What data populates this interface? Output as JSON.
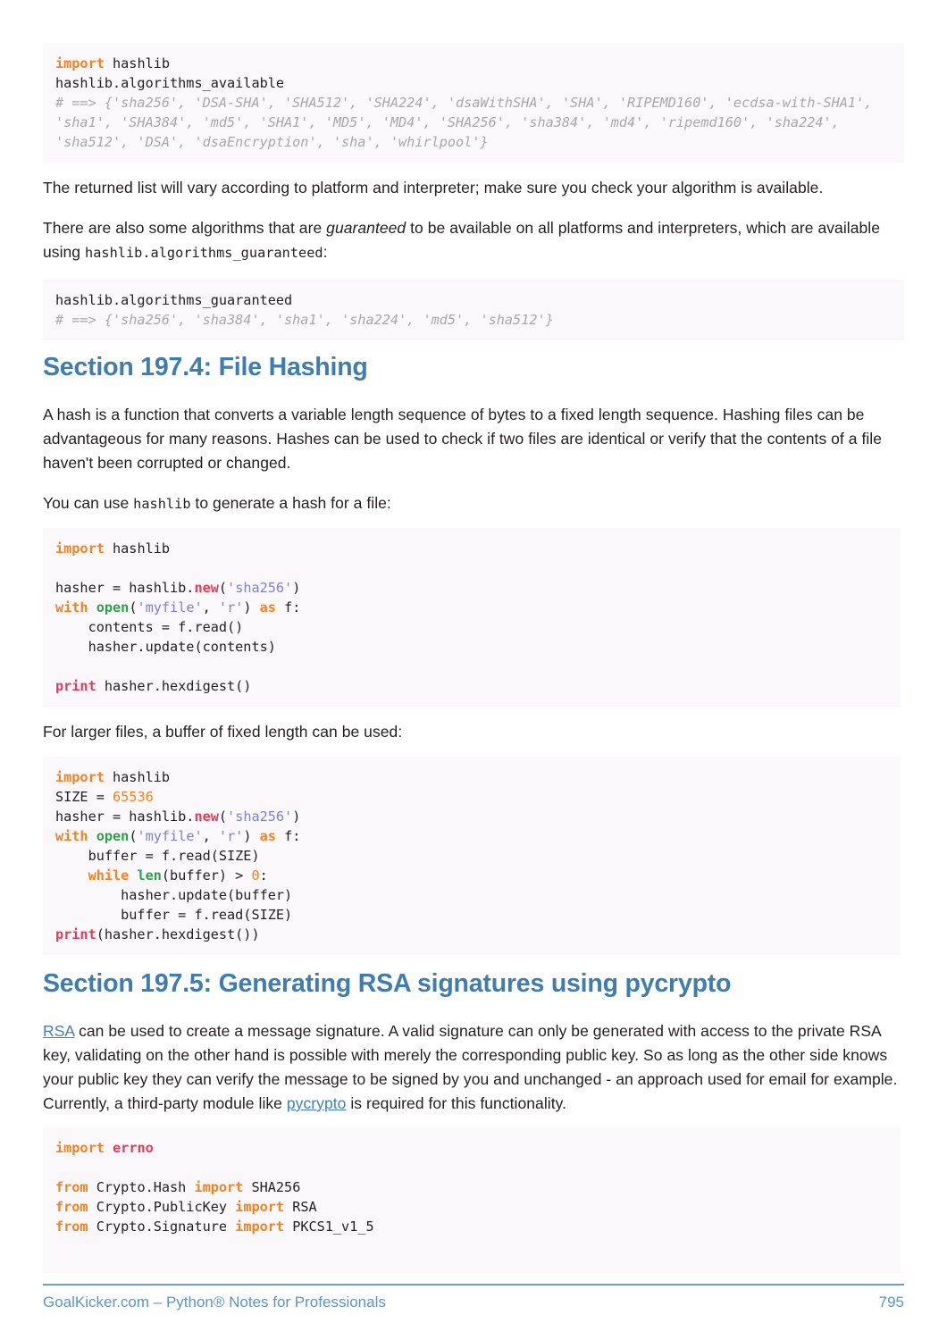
{
  "document": {
    "title": "Python Notes for Professionals",
    "page_number": "795"
  },
  "colors": {
    "heading": "#3f7cb0",
    "link": "#3f7fbf",
    "footer": "#5f93c0",
    "code_bg": "#faf8fb",
    "keyword": "#f58220",
    "function": "#e8395a",
    "builtin": "#2ea04f",
    "string": "#7f7fd0",
    "comment": "#a8a8a8"
  },
  "blocks": {
    "code1": {
      "l1_kw": "import",
      "l1_rest": " hashlib",
      "l2": "hashlib.algorithms_available",
      "l3": "# ==> {'sha256', 'DSA-SHA', 'SHA512', 'SHA224', 'dsaWithSHA', 'SHA', 'RIPEMD160', 'ecdsa-with-SHA1',",
      "l4": "'sha1', 'SHA384', 'md5', 'SHA1', 'MD5', 'MD4', 'SHA256', 'sha384', 'md4', 'ripemd160', 'sha224',",
      "l5": "'sha512', 'DSA', 'dsaEncryption', 'sha', 'whirlpool'}"
    },
    "para1": "The returned list will vary according to platform and interpreter; make sure you check your algorithm is available.",
    "para2": {
      "part1": "There are also some algorithms that are ",
      "em": "guaranteed",
      "part2": " to be available on all platforms and interpreters, which are available using ",
      "code": "hashlib.algorithms_guaranteed",
      "part3": ":"
    },
    "code2": {
      "l1": "hashlib.algorithms_guaranteed",
      "l2": "# ==> {'sha256', 'sha384', 'sha1', 'sha224', 'md5', 'sha512'}"
    },
    "heading1": "Section 197.4: File Hashing",
    "para3": "A hash is a function that converts a variable length sequence of bytes to a fixed length sequence. Hashing files can be advantageous for many reasons. Hashes can be used to check if two files are identical or verify that the contents of a file haven't been corrupted or changed.",
    "para4": {
      "part1": "You can use ",
      "code": "hashlib",
      "part2": " to generate a hash for a file:"
    },
    "code3": {
      "l1_kw": "import",
      "l1_rest": " hashlib",
      "l2": "",
      "l3_a": "hasher = hashlib.",
      "l3_fn": "new",
      "l3_b": "(",
      "l3_str": "'sha256'",
      "l3_c": ")",
      "l4_kw1": "with",
      "l4_a": " ",
      "l4_builtin": "open",
      "l4_b": "(",
      "l4_str1": "'myfile'",
      "l4_c": ", ",
      "l4_str2": "'r'",
      "l4_d": ") ",
      "l4_kw2": "as",
      "l4_e": " f:",
      "l5": "    contents = f.read()",
      "l6": "    hasher.update(contents)",
      "l7": "",
      "l8_fn": "print",
      "l8_rest": " hasher.hexdigest()"
    },
    "para5": "For larger files, a buffer of fixed length can be used:",
    "code4": {
      "l1_kw": "import",
      "l1_rest": " hashlib",
      "l2_a": "SIZE = ",
      "l2_num": "65536",
      "l3_a": "hasher = hashlib.",
      "l3_fn": "new",
      "l3_b": "(",
      "l3_str": "'sha256'",
      "l3_c": ")",
      "l4_kw1": "with",
      "l4_a": " ",
      "l4_builtin": "open",
      "l4_b": "(",
      "l4_str1": "'myfile'",
      "l4_c": ", ",
      "l4_str2": "'r'",
      "l4_d": ") ",
      "l4_kw2": "as",
      "l4_e": " f:",
      "l5": "    buffer = f.read(SIZE)",
      "l6_a": "    ",
      "l6_kw": "while",
      "l6_b": " ",
      "l6_builtin": "len",
      "l6_c": "(buffer) > ",
      "l6_num": "0",
      "l6_d": ":",
      "l7": "        hasher.update(buffer)",
      "l8": "        buffer = f.read(SIZE)",
      "l9_fn": "print",
      "l9_rest": "(hasher.hexdigest())"
    },
    "heading2": "Section 197.5: Generating RSA signatures using pycrypto",
    "para6": {
      "link1": "RSA",
      "part1": " can be used to create a message signature. A valid signature can only be generated with access to the private RSA key, validating on the other hand is possible with merely the corresponding public key. So as long as the other side knows your public key they can verify the message to be signed by you and unchanged - an approach used for email for example. Currently, a third-party module like ",
      "link2": "pycrypto",
      "part2": " is required for this functionality."
    },
    "code5": {
      "l1_kw": "import",
      "l1_a": " ",
      "l1_fn": "errno",
      "l2": "",
      "l3_kw1": "from",
      "l3_a": " Crypto.Hash ",
      "l3_kw2": "import",
      "l3_b": " SHA256",
      "l4_kw1": "from",
      "l4_a": " Crypto.PublicKey ",
      "l4_kw2": "import",
      "l4_b": " RSA",
      "l5_kw1": "from",
      "l5_a": " Crypto.Signature ",
      "l5_kw2": "import",
      "l5_b": " PKCS1_v1_5"
    }
  },
  "footer": {
    "left": "GoalKicker.com – Python® Notes for Professionals",
    "right": "795"
  }
}
